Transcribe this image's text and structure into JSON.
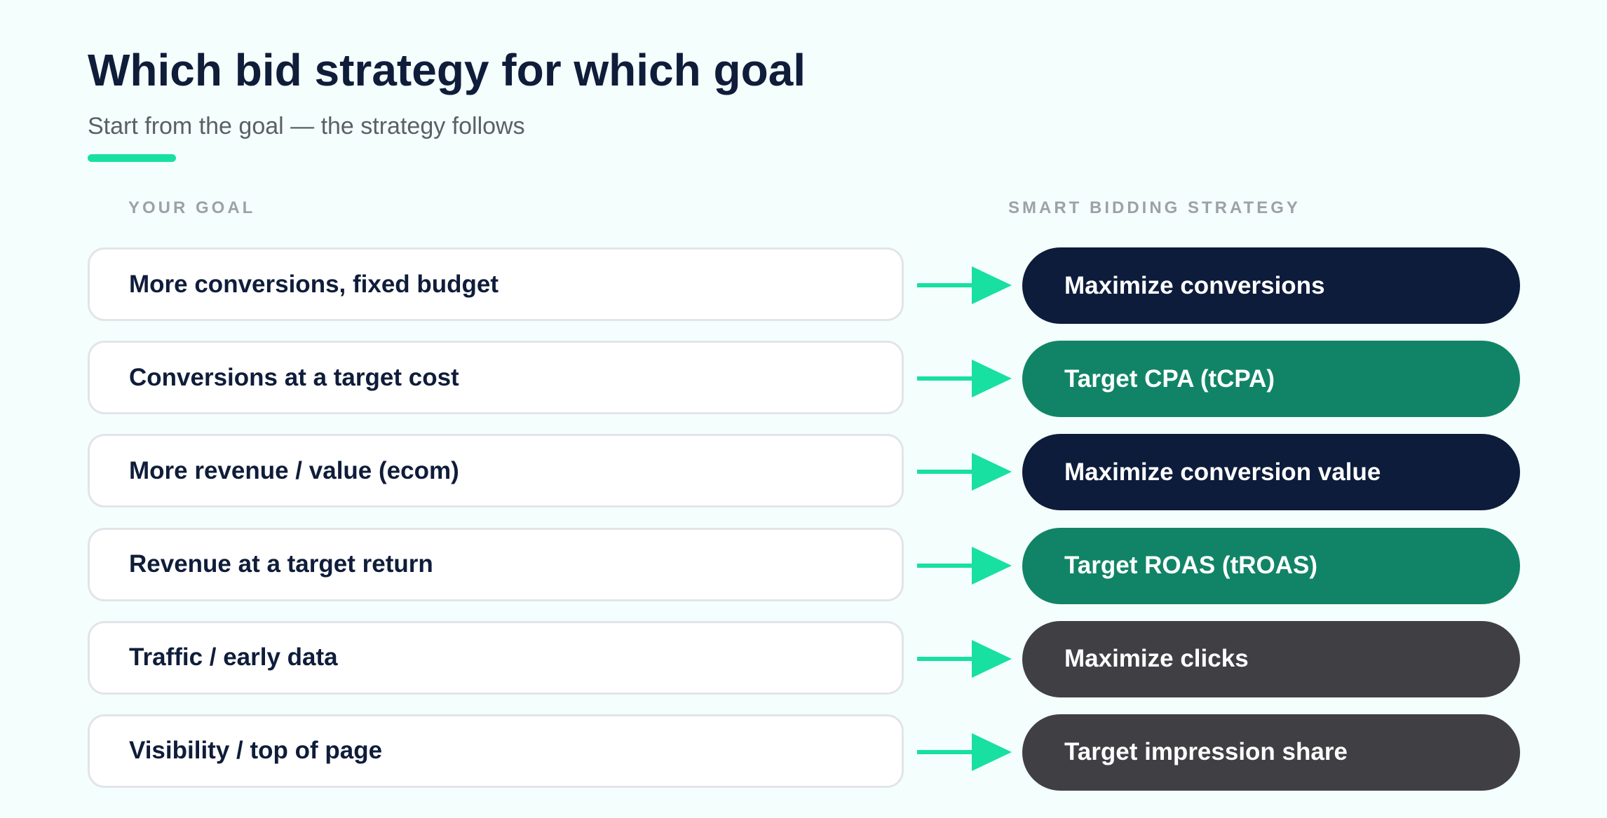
{
  "title": "Which bid strategy for which goal",
  "subtitle": "Start from the goal — the strategy follows",
  "columns": {
    "goal": "YOUR GOAL",
    "strategy": "SMART BIDDING STRATEGY"
  },
  "colors": {
    "navy": "#0d1c3b",
    "green": "#118467",
    "gray": "#3f3f44",
    "accent": "#17e0a1"
  },
  "rows": [
    {
      "goal": "More conversions, fixed budget",
      "strategy": "Maximize conversions",
      "color": "#0d1c3b"
    },
    {
      "goal": "Conversions at a target cost",
      "strategy": "Target CPA (tCPA)",
      "color": "#118467"
    },
    {
      "goal": "More revenue / value (ecom)",
      "strategy": "Maximize conversion value",
      "color": "#0d1c3b"
    },
    {
      "goal": "Revenue at a target return",
      "strategy": "Target ROAS (tROAS)",
      "color": "#118467"
    },
    {
      "goal": "Traffic / early data",
      "strategy": "Maximize clicks",
      "color": "#3f3f44"
    },
    {
      "goal": "Visibility / top of page",
      "strategy": "Target impression share",
      "color": "#3f3f44"
    }
  ]
}
